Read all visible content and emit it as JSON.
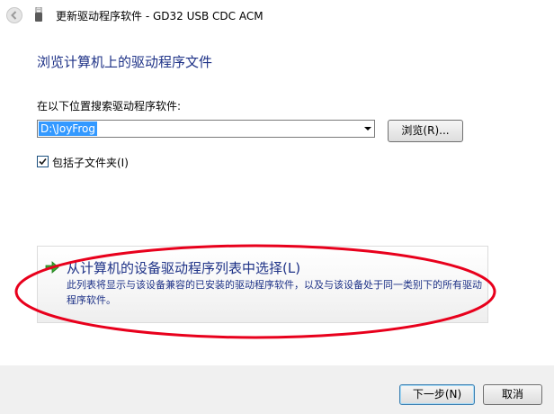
{
  "window": {
    "title": "更新驱动程序软件 - GD32 USB CDC ACM"
  },
  "page": {
    "heading": "浏览计算机上的驱动程序文件",
    "search_label": "在以下位置搜索驱动程序软件:",
    "path_value": "D:\\JoyFrog",
    "browse_label": "浏览(R)...",
    "include_subfolders_label": "包括子文件夹(I)",
    "include_subfolders_checked": true
  },
  "pick_option": {
    "title": "从计算机的设备驱动程序列表中选择(L)",
    "description": "此列表将显示与该设备兼容的已安装的驱动程序软件，以及与该设备处于同一类别下的所有驱动程序软件。",
    "icon": "green-arrow-icon",
    "highlight_color": "#e8001c"
  },
  "footer": {
    "next_label": "下一步(N)",
    "cancel_label": "取消"
  }
}
